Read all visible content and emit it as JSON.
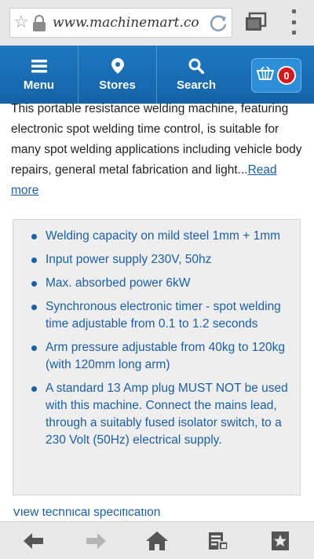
{
  "browser": {
    "url": "www.machinemart.co",
    "icons": [
      "star-icon",
      "lock-icon",
      "reload-icon",
      "tabs-icon",
      "overflow-menu-icon"
    ]
  },
  "nav": {
    "items": [
      {
        "label": "Menu",
        "icon": "hamburger-icon"
      },
      {
        "label": "Stores",
        "icon": "location-pin-icon"
      },
      {
        "label": "Search",
        "icon": "search-icon"
      }
    ],
    "basket_count": "0"
  },
  "content": {
    "intro": "This portable resistance welding machine, featuring electronic spot welding time control, is suitable for many spot welding applications including vehicle body repairs, general metal fabrication and light...",
    "read_more": "Read more",
    "features": [
      "Welding capacity on mild steel 1mm + 1mm",
      "Input power supply 230V, 50hz",
      "Max. absorbed power 6kW",
      "Synchronous electronic timer - spot welding time adjustable from 0.1 to 1.2 seconds",
      "Arm pressure adjustable from 40kg to 120kg (with 120mm long arm)",
      "A standard 13 Amp plug MUST NOT be used with this machine. Connect the mains lead, through a suitably fused isolator switch, to a 230 Volt (50Hz) electrical supply."
    ],
    "partial_link": "View technical specification"
  },
  "bottom_bar": {
    "icons": [
      "back-arrow-icon",
      "forward-arrow-icon",
      "home-icon",
      "reader-icon",
      "bookmarks-icon"
    ]
  },
  "colors": {
    "nav_blue": "#1a6fb6",
    "link_blue": "#1a5fa8",
    "badge_red": "#d8161c",
    "panel_grey": "#eeeeee"
  }
}
